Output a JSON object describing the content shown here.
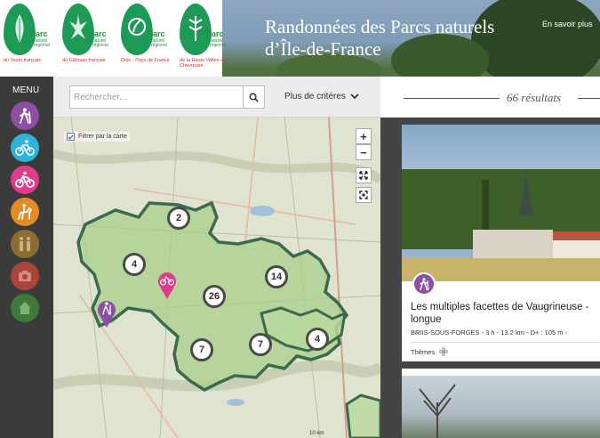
{
  "header": {
    "site_title": "Randonnées des Parcs naturels d’Île-de-France",
    "learn_more": "En savoir plus",
    "logos": [
      {
        "name": "Parc",
        "sub": "naturel régional",
        "location": "du Vexin français"
      },
      {
        "name": "Parc",
        "sub": "naturel régional",
        "location": "du Gâtinais français"
      },
      {
        "name": "Parc",
        "sub": "naturel régional",
        "location": "Oise - Pays de France"
      },
      {
        "name": "Parc",
        "sub": "naturel régional",
        "location": "de la Haute Vallée de Chevreuse"
      }
    ]
  },
  "nav": {
    "menu_label": "MENU",
    "buttons": [
      {
        "icon": "hiker-icon",
        "color": "#8c4fa3"
      },
      {
        "icon": "cyclist-icon",
        "color": "#2fb3d9"
      },
      {
        "icon": "mountain-bike-icon",
        "color": "#e23b87"
      },
      {
        "icon": "horse-rider-icon",
        "color": "#e58a24"
      },
      {
        "icon": "family-icon",
        "color": "#8a6e35"
      },
      {
        "icon": "camera-icon",
        "color": "#a9463c"
      },
      {
        "icon": "house-icon",
        "color": "#3d7a3a"
      }
    ]
  },
  "search": {
    "placeholder": "Rechercher...",
    "more_criteria": "Plus de critères"
  },
  "map": {
    "filter_label": "Filtrer par la carte",
    "filter_checked": true,
    "zoom_in": "+",
    "zoom_out": "−",
    "clusters": [
      {
        "label": "2"
      },
      {
        "label": "4"
      },
      {
        "label": "14"
      },
      {
        "label": "26"
      },
      {
        "label": "7"
      },
      {
        "label": "7"
      },
      {
        "label": "4"
      }
    ],
    "scale_label": "10 km"
  },
  "results": {
    "count_label": "66 résultats",
    "cards": [
      {
        "title": "Les multiples facettes de Vaugrineuse - longue",
        "meta": "BRIIS-SOUS-FORGES - 3 h - 13.2 km - D+ : 105 m -",
        "themes_label": "Thèmes"
      }
    ]
  },
  "colors": {
    "accent_purple": "#8c4fa3",
    "park_outline": "#3c6a4f",
    "park_fill": "#a9cf8c"
  }
}
